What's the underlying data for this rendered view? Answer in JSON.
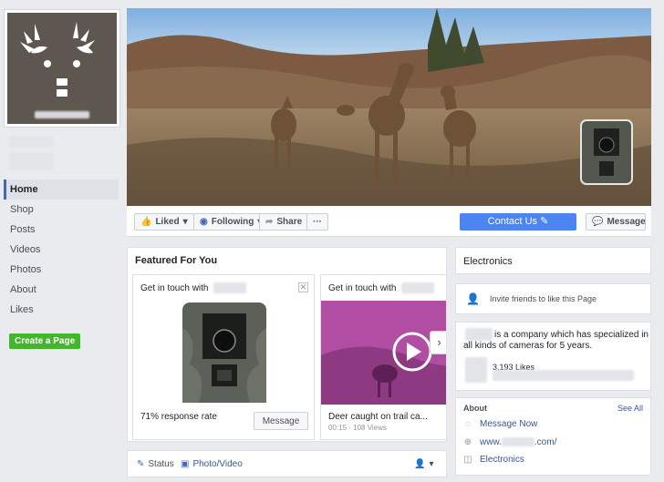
{
  "nav": {
    "items": [
      {
        "label": "Home",
        "active": true
      },
      {
        "label": "Shop"
      },
      {
        "label": "Posts"
      },
      {
        "label": "Videos"
      },
      {
        "label": "Photos"
      },
      {
        "label": "About"
      },
      {
        "label": "Likes"
      }
    ],
    "create_page_label": "Create a Page"
  },
  "actions": {
    "liked_label": "Liked",
    "following_label": "Following",
    "share_label": "Share",
    "more_label": "···",
    "contact_label": "Contact Us",
    "message_label": "Message"
  },
  "featured": {
    "title": "Featured For You",
    "cards": [
      {
        "head": "Get in touch with",
        "foot": "71% response rate",
        "button": "Message"
      },
      {
        "head": "Get in touch with",
        "foot": "Deer caught on trail ca...",
        "sub": "00:15 · 108 Views"
      }
    ]
  },
  "composer": {
    "status_label": "Status",
    "photo_label": "Photo/Video"
  },
  "right": {
    "category_title": "Electronics",
    "invite_text": "Invite friends to like this Page",
    "about_text_1": "is a company which has specialized in",
    "about_text_2": "all kinds of cameras for 5 years.",
    "likes_count": "3,193 Likes",
    "about_title": "About",
    "see_all": "See All",
    "message_now": "Message Now",
    "website_prefix": "www.",
    "website_suffix": ".com/",
    "category_link": "Electronics"
  },
  "colors": {
    "accent": "#4267b2",
    "contact_button": "#4c85f0",
    "create_button": "#42b72a"
  }
}
